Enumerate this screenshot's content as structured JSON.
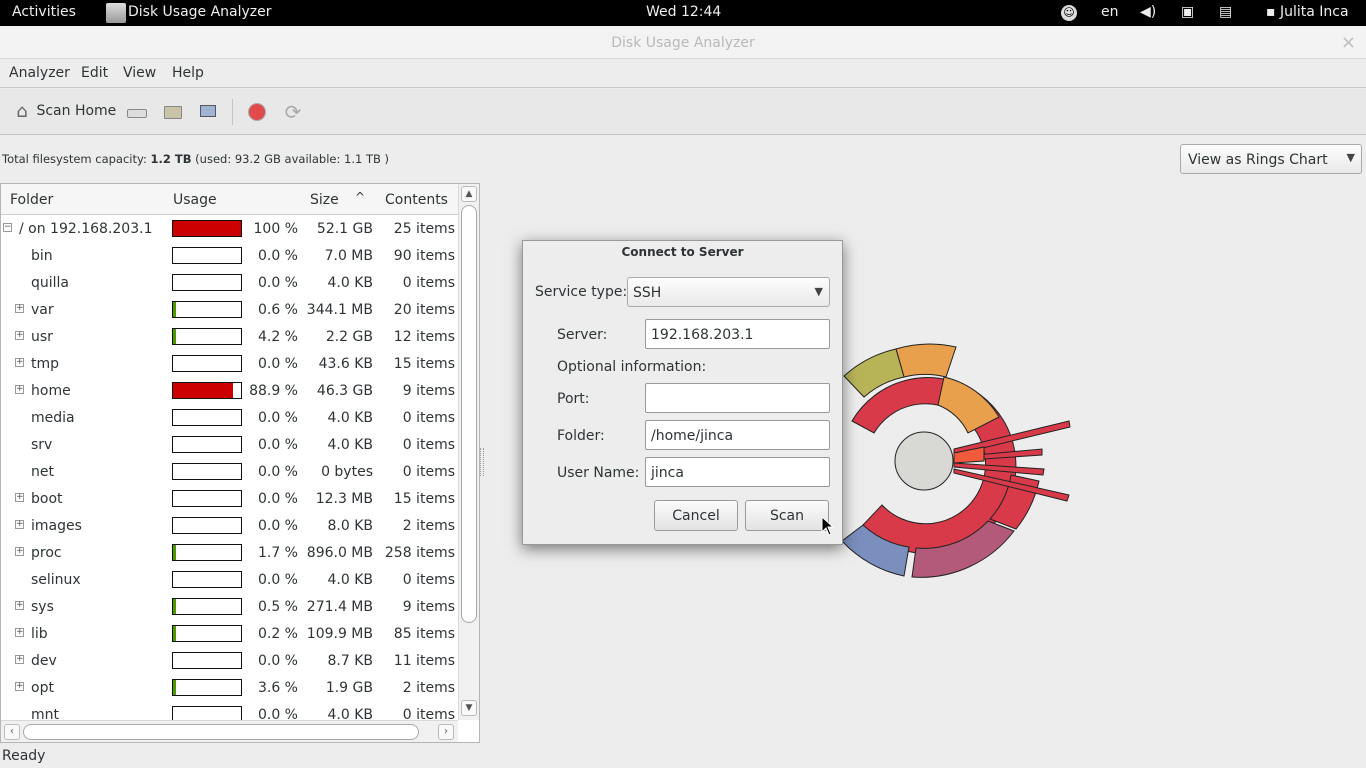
{
  "topbar": {
    "activities": "Activities",
    "app_name": "Disk Usage Analyzer",
    "clock": "Wed 12:44",
    "lang": "en",
    "user": "Julita Inca",
    "icons": [
      "accessibility-icon",
      "volume-icon",
      "network-icon",
      "power-icon"
    ]
  },
  "window": {
    "title": "Disk Usage Analyzer",
    "close_glyph": "×"
  },
  "menu": [
    "Analyzer",
    "Edit",
    "View",
    "Help"
  ],
  "toolbar": {
    "scan_home": "Scan Home",
    "icons": [
      "drive-icon",
      "folder-icon",
      "remote-icon",
      "stop-icon",
      "refresh-icon"
    ]
  },
  "capacity": {
    "prefix": "Total filesystem capacity:",
    "total": "1.2 TB",
    "detail": "(used: 93.2 GB available: 1.1 TB )"
  },
  "view_select": {
    "selected": "View as Rings Chart"
  },
  "tree": {
    "columns": [
      "Folder",
      "Usage",
      "Size",
      "Contents"
    ],
    "rows": [
      {
        "name": "/ on 192.168.203.1",
        "pct_value": 1.0,
        "pct": "100 %",
        "size": "52.1 GB",
        "contents": "25 items",
        "expander": "minus",
        "level": 0,
        "color": "#cc0000"
      },
      {
        "name": "bin",
        "pct_value": 0.0,
        "pct": "0.0 %",
        "size": "7.0 MB",
        "contents": "90 items",
        "expander": "none",
        "level": 1,
        "color": "#cc0000"
      },
      {
        "name": "quilla",
        "pct_value": 0.0,
        "pct": "0.0 %",
        "size": "4.0 KB",
        "contents": "0 items",
        "expander": "none",
        "level": 1,
        "color": "#cc0000"
      },
      {
        "name": "var",
        "pct_value": 0.006,
        "pct": "0.6 %",
        "size": "344.1 MB",
        "contents": "20 items",
        "expander": "plus",
        "level": 1,
        "color": "#4e9a06"
      },
      {
        "name": "usr",
        "pct_value": 0.042,
        "pct": "4.2 %",
        "size": "2.2 GB",
        "contents": "12 items",
        "expander": "plus",
        "level": 1,
        "color": "#4e9a06"
      },
      {
        "name": "tmp",
        "pct_value": 0.0,
        "pct": "0.0 %",
        "size": "43.6 KB",
        "contents": "15 items",
        "expander": "plus",
        "level": 1,
        "color": "#4e9a06"
      },
      {
        "name": "home",
        "pct_value": 0.889,
        "pct": "88.9 %",
        "size": "46.3 GB",
        "contents": "9 items",
        "expander": "plus",
        "level": 1,
        "color": "#cc0000"
      },
      {
        "name": "media",
        "pct_value": 0.0,
        "pct": "0.0 %",
        "size": "4.0 KB",
        "contents": "0 items",
        "expander": "none",
        "level": 1,
        "color": "#4e9a06"
      },
      {
        "name": "srv",
        "pct_value": 0.0,
        "pct": "0.0 %",
        "size": "4.0 KB",
        "contents": "0 items",
        "expander": "none",
        "level": 1,
        "color": "#4e9a06"
      },
      {
        "name": "net",
        "pct_value": 0.0,
        "pct": "0.0 %",
        "size": "0 bytes",
        "contents": "0 items",
        "expander": "none",
        "level": 1,
        "color": "#4e9a06"
      },
      {
        "name": "boot",
        "pct_value": 0.0,
        "pct": "0.0 %",
        "size": "12.3 MB",
        "contents": "15 items",
        "expander": "plus",
        "level": 1,
        "color": "#4e9a06"
      },
      {
        "name": "images",
        "pct_value": 0.0,
        "pct": "0.0 %",
        "size": "8.0 KB",
        "contents": "2 items",
        "expander": "plus",
        "level": 1,
        "color": "#4e9a06"
      },
      {
        "name": "proc",
        "pct_value": 0.017,
        "pct": "1.7 %",
        "size": "896.0 MB",
        "contents": "258 items",
        "expander": "plus",
        "level": 1,
        "color": "#4e9a06"
      },
      {
        "name": "selinux",
        "pct_value": 0.0,
        "pct": "0.0 %",
        "size": "4.0 KB",
        "contents": "0 items",
        "expander": "none",
        "level": 1,
        "color": "#4e9a06"
      },
      {
        "name": "sys",
        "pct_value": 0.005,
        "pct": "0.5 %",
        "size": "271.4 MB",
        "contents": "9 items",
        "expander": "plus",
        "level": 1,
        "color": "#4e9a06"
      },
      {
        "name": "lib",
        "pct_value": 0.002,
        "pct": "0.2 %",
        "size": "109.9 MB",
        "contents": "85 items",
        "expander": "plus",
        "level": 1,
        "color": "#4e9a06"
      },
      {
        "name": "dev",
        "pct_value": 0.0,
        "pct": "0.0 %",
        "size": "8.7 KB",
        "contents": "11 items",
        "expander": "plus",
        "level": 1,
        "color": "#4e9a06"
      },
      {
        "name": "opt",
        "pct_value": 0.036,
        "pct": "3.6 %",
        "size": "1.9 GB",
        "contents": "2 items",
        "expander": "plus",
        "level": 1,
        "color": "#4e9a06"
      },
      {
        "name": "mnt",
        "pct_value": 0.0,
        "pct": "0.0 %",
        "size": "4.0 KB",
        "contents": "0 items",
        "expander": "none",
        "level": 1,
        "color": "#4e9a06"
      }
    ]
  },
  "status": "Ready",
  "dialog": {
    "title": "Connect to Server",
    "service_type_label": "Service type:",
    "service_type_value": "SSH",
    "server_label": "Server:",
    "server_value": "192.168.203.1",
    "optional_label": "Optional information:",
    "port_label": "Port:",
    "port_value": "",
    "folder_label": "Folder:",
    "folder_value": "/home/jinca",
    "username_label": "User Name:",
    "username_value": "jinca",
    "cancel": "Cancel",
    "scan": "Scan"
  },
  "colors": {
    "accent_red": "#cc0000",
    "ring_red": "#d93a4a",
    "ring_blue": "#7a8fbd",
    "ring_purple": "#b35a7a",
    "ring_orange": "#e8a04c",
    "ring_olive": "#b7b458"
  }
}
